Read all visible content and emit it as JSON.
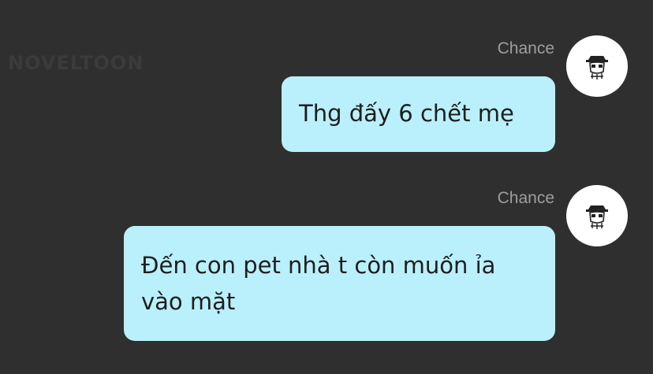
{
  "watermark": {
    "logo_text": "NOVELTOON",
    "sub_text": ""
  },
  "messages": [
    {
      "sender": "Chance",
      "text": "Thg đấy 6 chết mẹ",
      "avatar_icon": "chibi-avatar-icon"
    },
    {
      "sender": "Chance",
      "text": "Đến con pet nhà t còn muốn ỉa vào mặt",
      "avatar_icon": "chibi-avatar-icon"
    }
  ],
  "colors": {
    "background": "#2f2f2f",
    "bubble": "#baf0fc",
    "sender_name": "#9e9e9e",
    "avatar_bg": "#ffffff"
  }
}
